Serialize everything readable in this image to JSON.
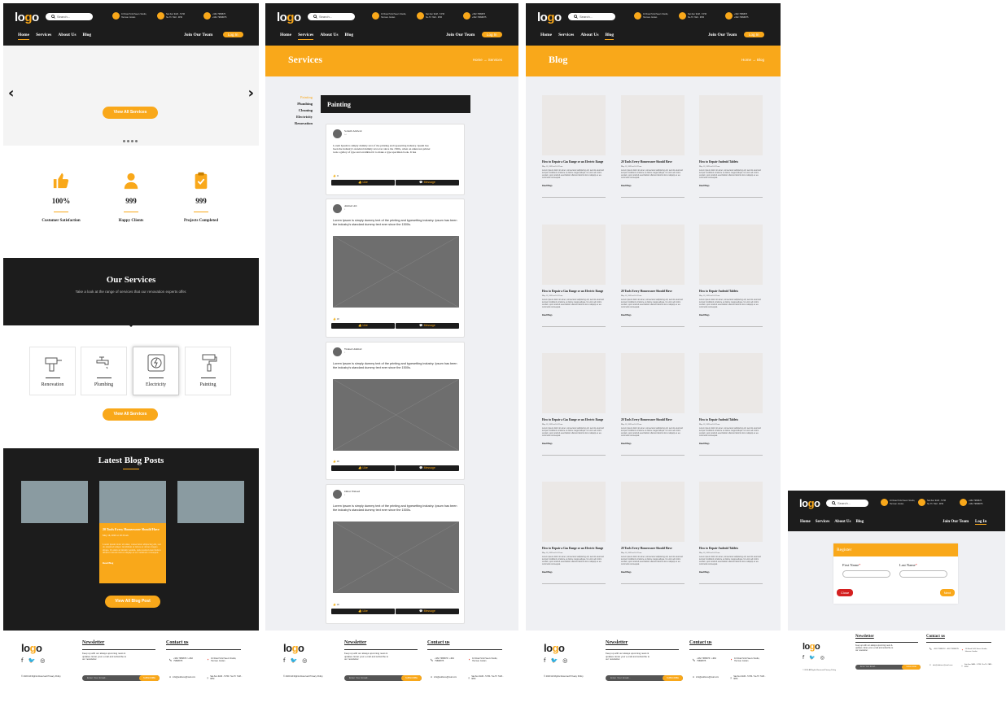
{
  "header": {
    "logo": "logo",
    "search_placeholder": "Search...",
    "addr1": "10 Road St El Seers Studio,",
    "addr2": "Herman Jordan",
    "time1": "Sat-Sun 9AM - 5 PM",
    "time2": "Su-Th 7AM - 9PM",
    "phone1": "+962 7989876",
    "phone2": "+962 79898875",
    "nav": [
      "Home",
      "Services",
      "About Us",
      "Blog"
    ],
    "join": "Join Our Team",
    "login": "Log In"
  },
  "home": {
    "prev_icon": "chevron-left-icon",
    "next_icon": "chevron-right-icon",
    "hero_button": "View All Services",
    "stats": [
      {
        "icon": "thumbs-up-icon",
        "value": "100%",
        "label": "Customer Satisfaction"
      },
      {
        "icon": "user-icon",
        "value": "999",
        "label": "Happy Clients"
      },
      {
        "icon": "clipboard-check-icon",
        "value": "999",
        "label": "Projects Completed"
      }
    ],
    "services_title": "Our Services",
    "services_sub": "Take a look at the range of services that our renovation experts offer.",
    "services": [
      {
        "icon": "drill-icon",
        "label": "Renovation"
      },
      {
        "icon": "faucet-icon",
        "label": "Plumbing"
      },
      {
        "icon": "outlet-icon",
        "label": "Electricity"
      },
      {
        "icon": "paint-roller-icon",
        "label": "Painting"
      }
    ],
    "services_button": "View All Services",
    "blog_title": "Latest Blog Posts",
    "blog_card_title": "20 Tools Every Homeowner Should Have",
    "blog_card_date": "May 16, 2020 at 10:19 am",
    "blog_card_text": "Lorem ipsum dolor sit amet, consectetur adipiscing elit, sed do eiusmod tempor incididunt ut labore et dolore magna aliqua. Ut enim ad minim veniam, quis nostrud exercitation ullamco laboris nisi ut aliquip ex ea commodo consequat.",
    "blog_card_read": "Read Blog",
    "blog_button": "View All Blog Post"
  },
  "services_page": {
    "title": "Services",
    "breadcrumb_home": "Home",
    "breadcrumb_current": "Services",
    "sidebar": [
      "Painting",
      "Plumbing",
      "Cleaning",
      "Electricity",
      "Renovation"
    ],
    "active": "Painting",
    "posts": [
      {
        "user": "Sohaib Alalwal",
        "time": "1d",
        "text": "Lorem Ipsum is simply dummy text of the printing and typesetting industry. Ipsum has been the industry's standard dummy text ever since the 1500s, when an unknown printer took a galley of type and scrambled it to make a type specimen book. It has",
        "likes": "11"
      },
      {
        "user": "Ahmed Ali",
        "time": "2",
        "text": "Lorem Ipsum is simply dummy text of the printing and typesetting industry. Ipsum has been the industry's standard dummy text ever since the 1500s.",
        "likes": "10"
      },
      {
        "user": "Waleed Ahmad",
        "time": "2",
        "text": "Lorem Ipsum is simply dummy text of the printing and typesetting industry. Ipsum has been the industry's standard dummy text ever since the 1500s.",
        "likes": "10"
      },
      {
        "user": "Omar Waleed",
        "time": "2",
        "text": "Lorem Ipsum is simply dummy text of the printing and typesetting industry. Ipsum has been the industry's standard dummy text ever since the 1500s.",
        "likes": "10"
      }
    ],
    "like_label": "Like",
    "message_label": "Message"
  },
  "blog_page": {
    "title": "Blog",
    "breadcrumb_home": "Home",
    "breadcrumb_current": "Blog",
    "card_titles": [
      "How to Repair a Gas Range or an Electric Range",
      "20 Tools Every Homeowner Should Have",
      "How to Repair Android Tablets"
    ],
    "card_date": "May 16, 2020 at 10:19 am",
    "card_text": "Lorem ipsum dolor sit amet, consectetur adipiscing elit, sed do eiusmod tempor incididunt ut labore et dolore magna aliqua. Ut enim ad minim veniam, quis nostrud exercitation ullamco laboris nisi ut aliquip ex ea commodo consequat.",
    "read": "Read Blogs"
  },
  "register": {
    "title": "Register",
    "first": "First Name",
    "last": "Last Name",
    "req": "*",
    "close": "Close",
    "next": "Next"
  },
  "footer": {
    "logo": "logo",
    "copyright": "© 2020 All Rights Reserved Privacy Policy",
    "newsletter_title": "Newsletter",
    "newsletter_text": "Keep up with our always upcoming news & updates. Enter your e-mail and subscribe to our newsletter.",
    "email_placeholder": "Enter Your Email...",
    "subscribe": "SUBSCRIBE",
    "contact_title": "Contact us",
    "phone": "+962 7989876 / +962 79898875",
    "address": "10 Road St El Seers Studio, Herman Jordan",
    "email": "info@address@mail.com",
    "hours": "Sat-Sun 9AM - 5 PM / Su-Th 7AM - 9PM"
  },
  "colors": {
    "accent": "#f9a81a",
    "dark": "#1c1c1c",
    "light_bg": "#eff0f3",
    "danger": "#d42020"
  }
}
